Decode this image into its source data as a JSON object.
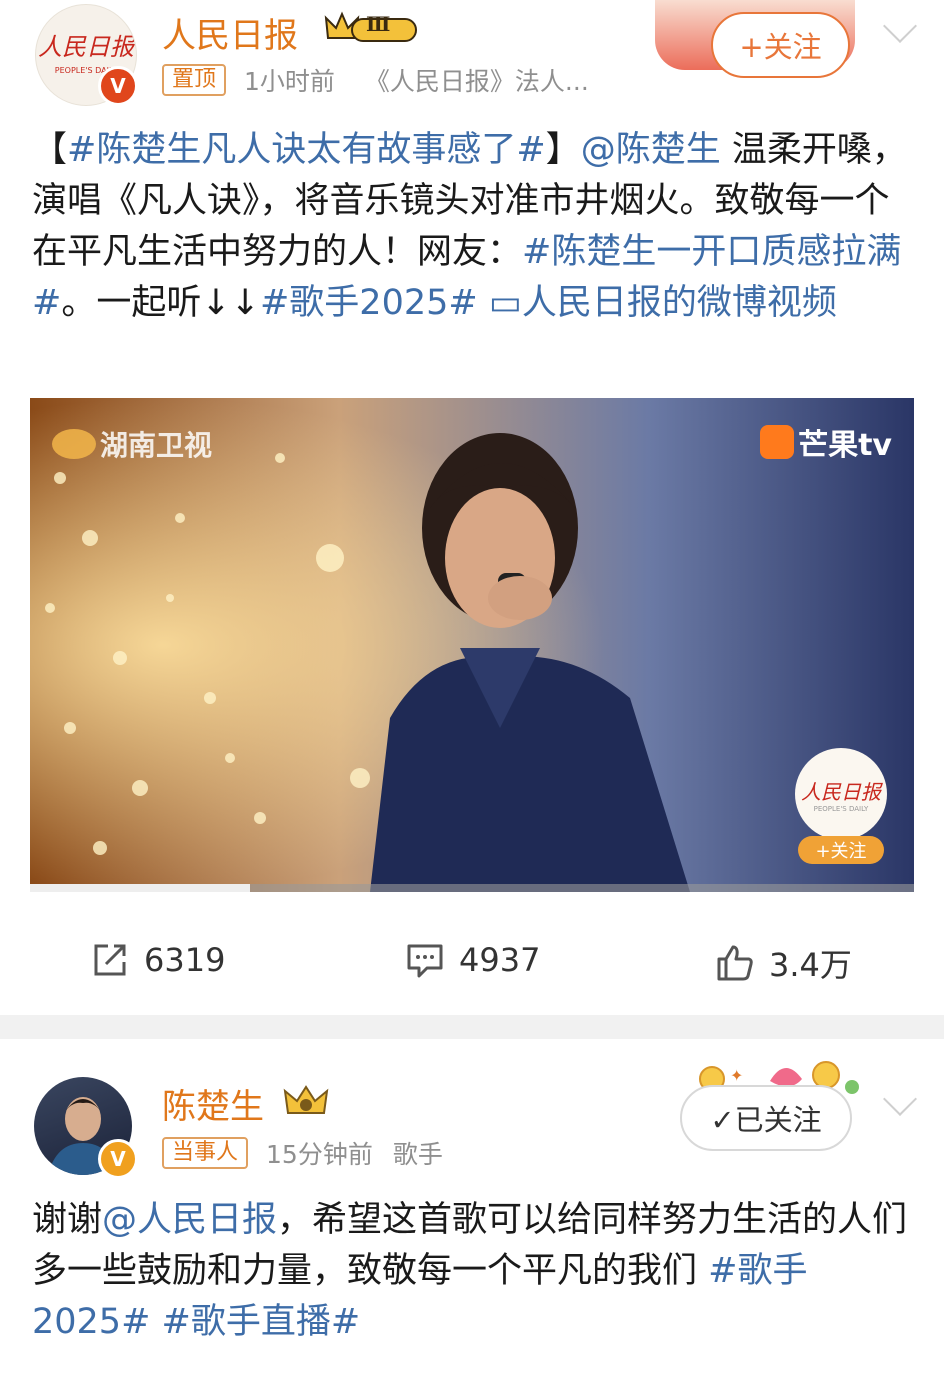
{
  "post1": {
    "author": "人民日报",
    "level_badge": "Ⅲ",
    "pinned_tag": "置顶",
    "time": "1小时前",
    "source": "《人民日报》法人...",
    "follow_label": "+关注",
    "text": {
      "p1": "【",
      "p2": "#陈楚生凡人诀太有故事感了#",
      "p3": "】",
      "p4": "@陈楚生",
      "p5": " 温柔开嗓，演唱《凡人诀》，将音乐镜头对准市井烟火。致敬每一个在平凡生活中努力的人！网友：",
      "p6": "#陈楚生一开口质感拉满#",
      "p7": "。一起听↓↓",
      "p8": "#歌手2025#",
      "p9": " ▭",
      "p10": "人民日报的微博视频"
    },
    "video": {
      "left_watermark": "湖南卫视",
      "right_watermark": "芒果tv",
      "overlay_logo": "人民日报",
      "overlay_logo_sub": "PEOPLE'S DAILY",
      "overlay_follow": "+关注"
    },
    "repost_count": "6319",
    "comment_count": "4937",
    "like_count": "3.4万"
  },
  "post2": {
    "author": "陈楚生",
    "tag": "当事人",
    "time": "15分钟前",
    "role": "歌手",
    "follow_label": "✓已关注",
    "text": {
      "p1": "谢谢",
      "p2": "@人民日报",
      "p3": "，希望这首歌可以给同样努力生活的人们多一些鼓励和力量，致敬每一个平凡的我们 ",
      "p4": "#歌手2025#",
      "p5": " ",
      "p6": "#歌手直播#"
    }
  },
  "colors": {
    "username": "#e0771b",
    "link": "#3e6da8",
    "verified": "#e0461c",
    "meta": "#8f8f8f"
  }
}
